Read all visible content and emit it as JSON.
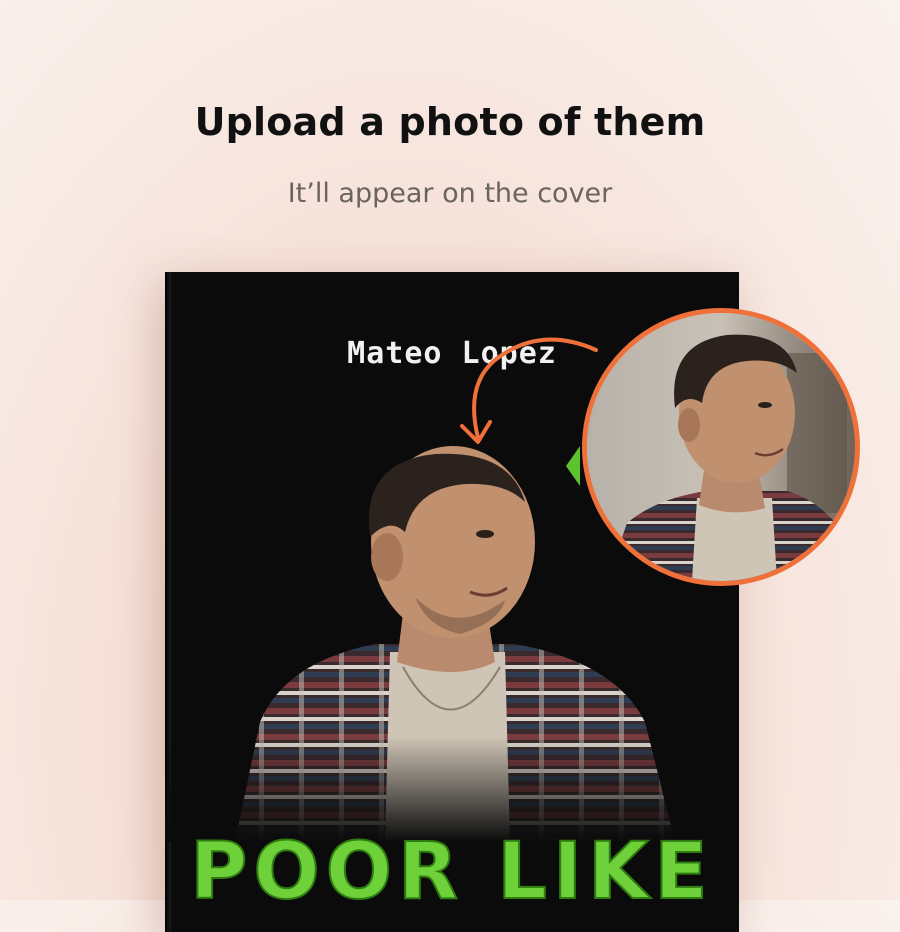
{
  "header": {
    "title": "Upload a photo of them",
    "subtitle": "It’ll appear on the cover"
  },
  "book": {
    "author_name": "Mateo Lopez",
    "title_partial": "POOR LIKE"
  },
  "colors": {
    "accent_orange": "#f0703a",
    "title_green": "#6fd13a",
    "cover_black": "#0b0b0b"
  },
  "icons": {
    "arrow": "curved-arrow-icon"
  }
}
